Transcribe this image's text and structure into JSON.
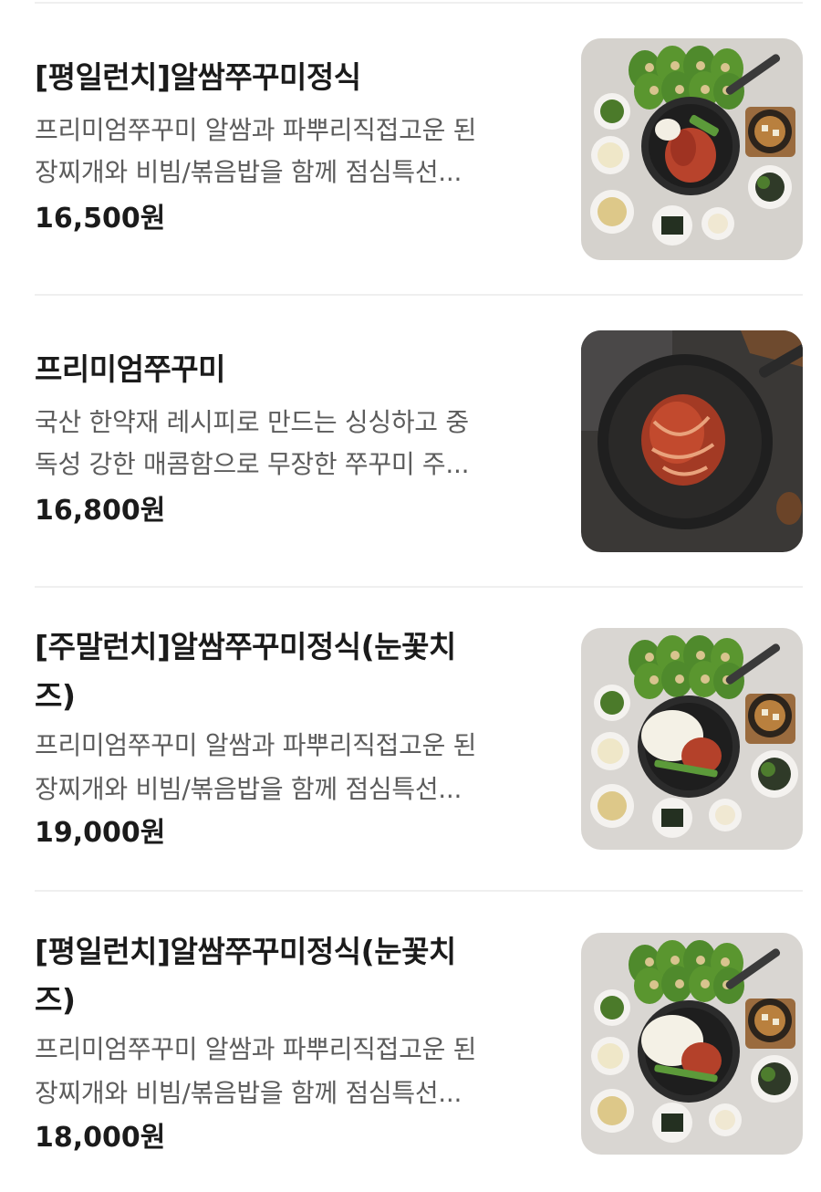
{
  "menu_items": [
    {
      "title": "[평일런치]알쌈쭈꾸미정식",
      "desc_line1": "프리미엄쭈꾸미 알쌈과 파뿌리직접고운 된",
      "desc_line2": "장찌개와 비빔/볶음밥을 함께 점심특선...",
      "price": "16,500원",
      "image": "set-meal-photo"
    },
    {
      "title": "프리미엄쭈꾸미",
      "desc_line1": "국산 한약재 레시피로 만드는 싱싱하고 중",
      "desc_line2": "독성 강한 매콤함으로 무장한 쭈꾸미 주...",
      "price": "16,800원",
      "image": "webfoot-octopus-pan-photo"
    },
    {
      "title_line1": "[주말런치]알쌈쭈꾸미정식(눈꽃치",
      "title_line2": "즈)",
      "desc_line1": "프리미엄쭈꾸미 알쌈과 파뿌리직접고운 된",
      "desc_line2": "장찌개와 비빔/볶음밥을 함께 점심특선...",
      "price": "19,000원",
      "image": "cheese-set-meal-photo"
    },
    {
      "title_line1": "[평일런치]알쌈쭈꾸미정식(눈꽃치",
      "title_line2": "즈)",
      "desc_line1": "프리미엄쭈꾸미 알쌈과 파뿌리직접고운 된",
      "desc_line2": "장찌개와 비빔/볶음밥을 함께 점심특선...",
      "price": "18,000원",
      "image": "cheese-set-meal-photo"
    }
  ]
}
